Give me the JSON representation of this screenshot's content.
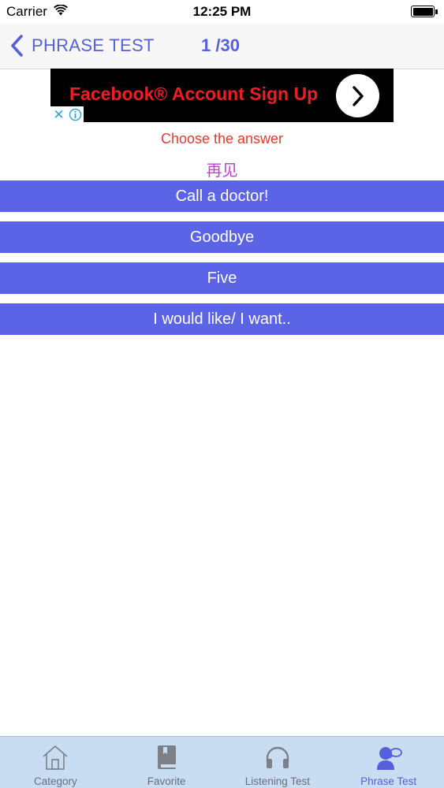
{
  "status_bar": {
    "carrier": "Carrier",
    "time": "12:25 PM"
  },
  "nav": {
    "back_label": "PHRASE TEST",
    "counter": "1 /30"
  },
  "ad": {
    "text": "Facebook® Account Sign Up",
    "close_glyph": "✕",
    "text_color": "#ee1c25"
  },
  "quiz": {
    "prompt": "Choose the answer",
    "question": "再见",
    "answers": [
      "Call a doctor!",
      "Goodbye",
      "Five",
      "I would like/ I want.."
    ]
  },
  "tabs": [
    {
      "label": "Category",
      "icon": "house-icon"
    },
    {
      "label": "Favorite",
      "icon": "book-icon"
    },
    {
      "label": "Listening Test",
      "icon": "headphones-icon"
    },
    {
      "label": "Phrase Test",
      "icon": "person-speech-icon",
      "active": true
    }
  ],
  "colors": {
    "accent": "#5560db",
    "answer_button": "#5b63e6",
    "prompt": "#e23b2f",
    "question": "#c63ee0",
    "tab_bar": "#c8dcf2"
  }
}
